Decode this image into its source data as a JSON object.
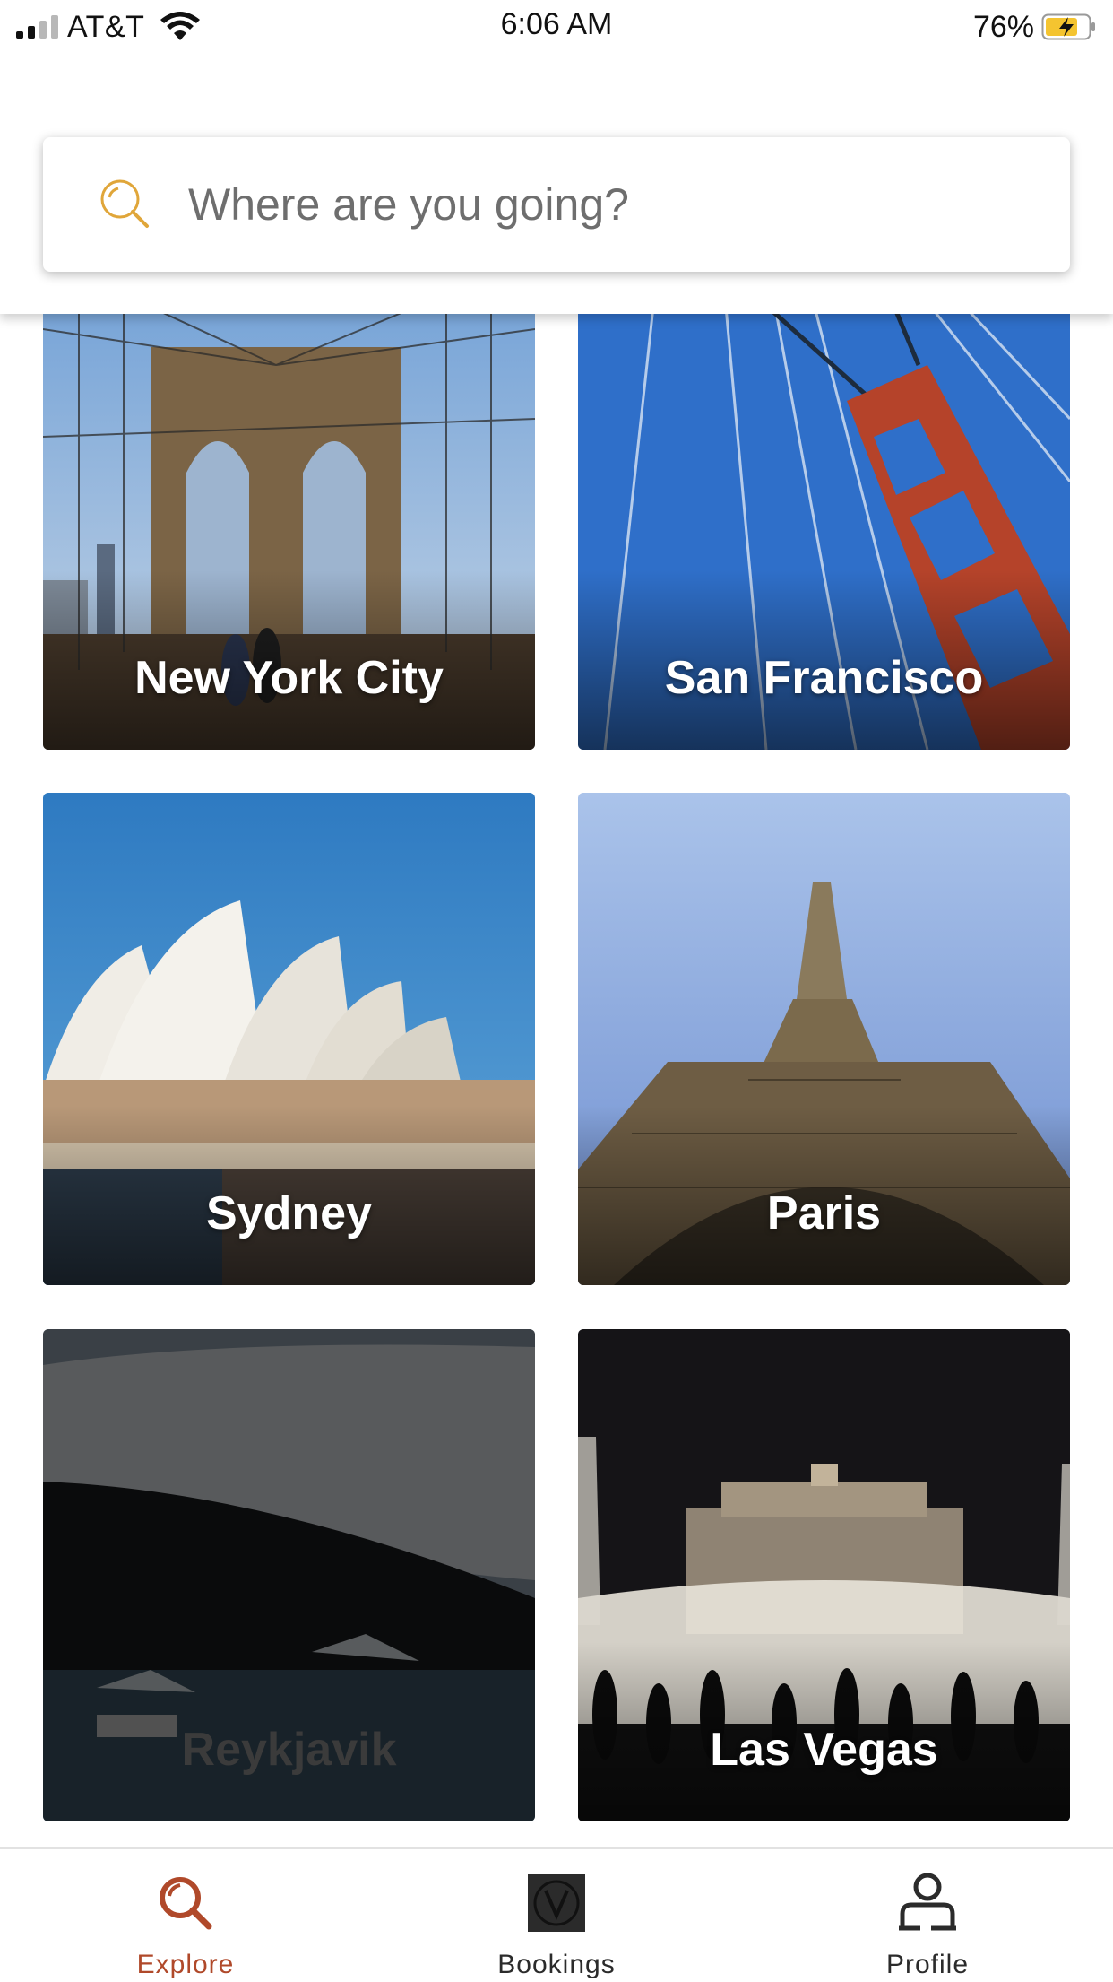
{
  "status_bar": {
    "carrier": "AT&T",
    "time": "6:06 AM",
    "battery_percent": "76%",
    "battery_level": 0.76,
    "signal_bars": 2,
    "signal_total": 4,
    "icons": [
      "signal-icon",
      "wifi-icon",
      "battery-charging-icon"
    ]
  },
  "search": {
    "placeholder": "Where are you going?",
    "icon": "search-icon",
    "icon_color": "#e0a63a"
  },
  "destinations": [
    {
      "name": "New York City",
      "dimmed": false
    },
    {
      "name": "San Francisco",
      "dimmed": false
    },
    {
      "name": "Sydney",
      "dimmed": false
    },
    {
      "name": "Paris",
      "dimmed": false
    },
    {
      "name": "Reykjavik",
      "dimmed": true
    },
    {
      "name": "Las Vegas",
      "dimmed": false
    }
  ],
  "tab_bar": {
    "active_color": "#b0492a",
    "tabs": [
      {
        "label": "Explore",
        "icon": "search-icon",
        "active": true
      },
      {
        "label": "Bookings",
        "icon": "bookings-icon",
        "active": false
      },
      {
        "label": "Profile",
        "icon": "profile-icon",
        "active": false
      }
    ]
  }
}
